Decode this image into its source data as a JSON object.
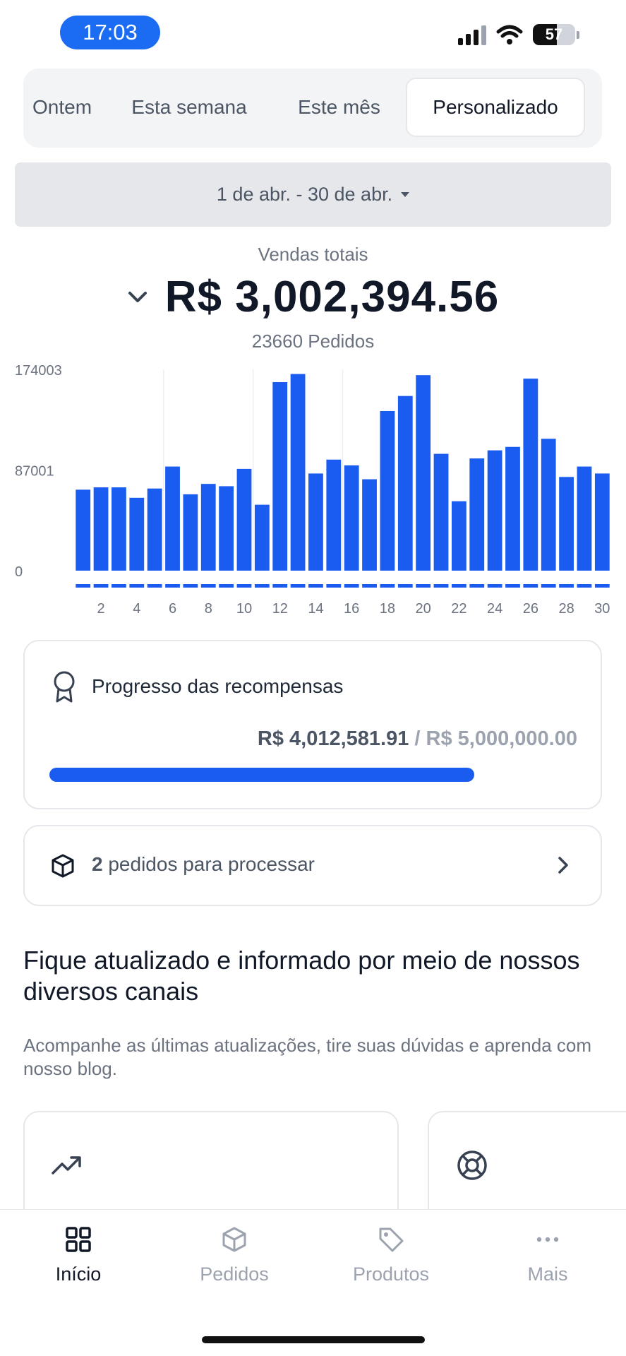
{
  "status_bar": {
    "time": "17:03",
    "battery": "57"
  },
  "period_tabs": [
    {
      "label": "Ontem",
      "active": false
    },
    {
      "label": "Esta semana",
      "active": false
    },
    {
      "label": "Este mês",
      "active": false
    },
    {
      "label": "Personalizado",
      "active": true
    }
  ],
  "date_range": {
    "label": "1 de abr. - 30 de abr."
  },
  "summary": {
    "label": "Vendas totais",
    "total": "R$ 3,002,394.56",
    "orders": "23660 Pedidos"
  },
  "chart_data": {
    "type": "bar",
    "categories": [
      1,
      2,
      3,
      4,
      5,
      6,
      7,
      8,
      9,
      10,
      11,
      12,
      13,
      14,
      15,
      16,
      17,
      18,
      19,
      20,
      21,
      22,
      23,
      24,
      25,
      26,
      27,
      28,
      29,
      30
    ],
    "x_tick_labels": [
      "2",
      "4",
      "6",
      "8",
      "10",
      "12",
      "14",
      "16",
      "18",
      "20",
      "22",
      "24",
      "26",
      "28",
      "30"
    ],
    "values": [
      70000,
      72000,
      72000,
      63000,
      71000,
      90000,
      66000,
      75000,
      73000,
      88000,
      57000,
      163000,
      170000,
      84000,
      96000,
      91000,
      79000,
      138000,
      151000,
      169000,
      101000,
      60000,
      97000,
      104000,
      107000,
      166000,
      114000,
      81000,
      90000,
      84000
    ],
    "y_tick_labels": [
      "174003",
      "87001",
      "0"
    ],
    "ylim": [
      0,
      174003
    ],
    "grid": true,
    "color": "#1b5cf0"
  },
  "rewards": {
    "title": "Progresso das recompensas",
    "current": "R$ 4,012,581.91",
    "separator": " / ",
    "goal": "R$ 5,000,000.00",
    "progress_fraction": 0.8025
  },
  "orders_card": {
    "count": "2",
    "text": " pedidos para processar"
  },
  "info": {
    "title": "Fique atualizado e informado por meio de nossos diversos canais",
    "description": "Acompanhe as últimas atualizações, tire suas dúvidas e aprenda com nosso blog."
  },
  "cards": [
    {
      "icon": "trending-up-icon"
    },
    {
      "icon": "lifebuoy-icon"
    }
  ],
  "bottom_nav": [
    {
      "label": "Início",
      "icon": "grid-icon",
      "active": true
    },
    {
      "label": "Pedidos",
      "icon": "box-icon",
      "active": false
    },
    {
      "label": "Produtos",
      "icon": "tag-icon",
      "active": false
    },
    {
      "label": "Mais",
      "icon": "more-icon",
      "active": false
    }
  ]
}
